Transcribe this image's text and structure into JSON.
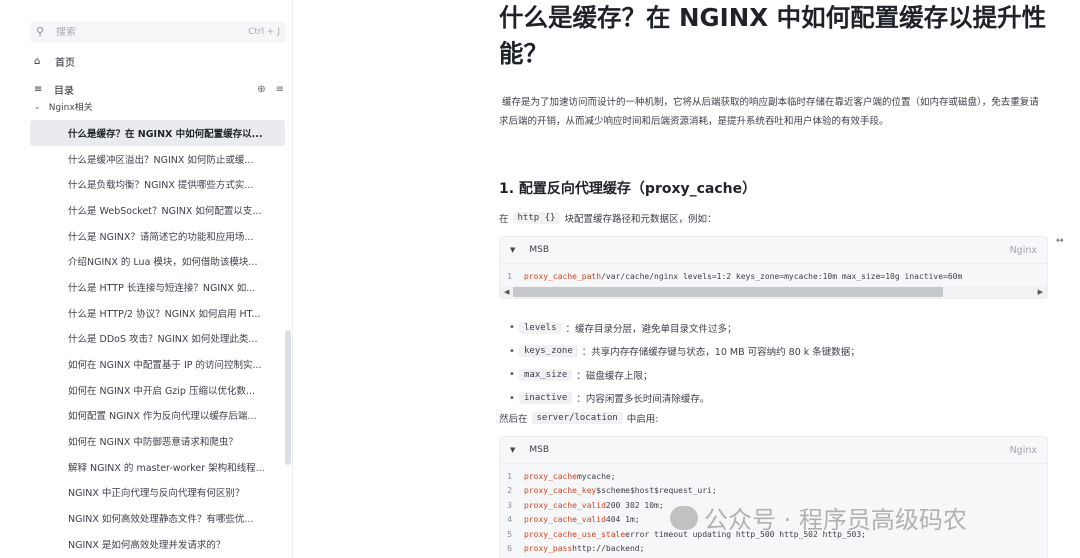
{
  "sidebar": {
    "search": {
      "placeholder": "搜索",
      "shortcut": "Ctrl + J"
    },
    "home_label": "首页",
    "toc_label": "目录",
    "group_label": "Nginx相关",
    "items": [
      {
        "label": "什么是缓存？在 NGINX 中如何配置缓存以..."
      },
      {
        "label": "什么是缓冲区溢出？NGINX 如何防止或缓..."
      },
      {
        "label": "什么是负载均衡？NGINX 提供哪些方式实..."
      },
      {
        "label": "什么是 WebSocket？NGINX 如何配置以支..."
      },
      {
        "label": "什么是 NGINX？请简述它的功能和应用场..."
      },
      {
        "label": "介绍NGINX 的 Lua 模块，如何借助该模块..."
      },
      {
        "label": "什么是 HTTP 长连接与短连接？NGINX 如..."
      },
      {
        "label": "什么是 HTTP/2 协议？NGINX 如何启用 HT..."
      },
      {
        "label": "什么是 DDoS 攻击？NGINX 如何处理此类..."
      },
      {
        "label": "如何在 NGINX 中配置基于 IP 的访问控制实..."
      },
      {
        "label": "如何在 NGINX 中开启 Gzip 压缩以优化数..."
      },
      {
        "label": "如何配置 NGINX 作为反向代理以缓存后端..."
      },
      {
        "label": "如何在 NGINX 中防御恶意请求和爬虫？"
      },
      {
        "label": "解释 NGINX 的 master-worker 架构和线程..."
      },
      {
        "label": "NGINX 中正向代理与反向代理有何区别？"
      },
      {
        "label": "NGINX 如何高效处理静态文件？有哪些优..."
      },
      {
        "label": "NGINX 是如何高效处理并发请求的？"
      }
    ]
  },
  "article": {
    "title": "什么是缓存？在 NGINX 中如何配置缓存以提升性能？",
    "intro": "缓存是为了加速访问而设计的一种机制，它将从后端获取的响应副本临时存储在靠近客户端的位置（如内存或磁盘），免去重复请求后端的开销，从而减少响应时间和后端资源消耗，是提升系统吞吐和用户体验的有效手段。",
    "section1_title": "1. 配置反向代理缓存（proxy_cache）",
    "p1_prefix": "在",
    "p1_code": "http {}",
    "p1_suffix": "块配置缓存路径和元数据区，例如：",
    "code1": {
      "toggle": "MSB",
      "lang": "Nginx",
      "lines": [
        {
          "n": "1",
          "kw": "proxy_cache_path",
          "rest": " /var/cache/nginx levels=1:2 keys_zone=mycache:10m max_size=10g inactive=60m"
        }
      ]
    },
    "bullets": [
      {
        "code": "levels",
        "text": "：缓存目录分层，避免单目录文件过多；"
      },
      {
        "code": "keys_zone",
        "text": "：共享内存存储缓存键与状态，10 MB 可容纳约 80 k 条键数据；"
      },
      {
        "code": "max_size",
        "text": "：磁盘缓存上限；"
      },
      {
        "code": "inactive",
        "text": "：内容闲置多长时间清除缓存。"
      }
    ],
    "p2_prefix": "然后在",
    "p2_code": "server/location",
    "p2_suffix": "中启用:",
    "code2": {
      "toggle": "MSB",
      "lang": "Nginx",
      "lines": [
        {
          "n": "1",
          "kw": "proxy_cache",
          "rest": " mycache;"
        },
        {
          "n": "2",
          "kw": "proxy_cache_key",
          "rest": " $scheme$host$request_uri;"
        },
        {
          "n": "3",
          "kw": "proxy_cache_valid",
          "rest": " 200 302 10m;"
        },
        {
          "n": "4",
          "kw": "proxy_cache_valid",
          "rest": " 404 1m;"
        },
        {
          "n": "5",
          "kw": "proxy_cache_use_stale",
          "rest": " error timeout updating http_500 http_502 http_503;"
        },
        {
          "n": "6",
          "kw": "proxy_pass",
          "rest": " http://backend;"
        }
      ]
    }
  },
  "watermark": {
    "text": "公众号 · 程序员高级码农"
  }
}
